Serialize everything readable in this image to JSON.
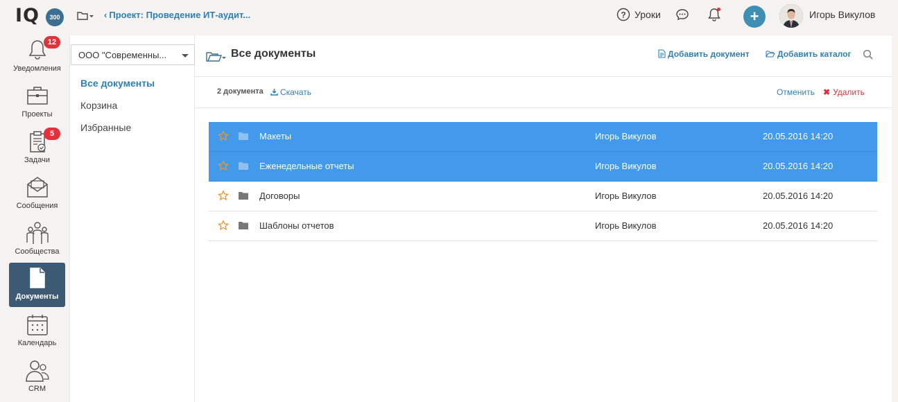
{
  "header": {
    "logo_text": "IQ",
    "logo_badge": "300",
    "breadcrumb": "Проект: Проведение ИТ-аудит...",
    "help_label": "Уроки",
    "user_name": "Игорь Викулов",
    "add_label": "+"
  },
  "nav": {
    "items": [
      {
        "label": "Уведомления",
        "icon": "bell-icon",
        "badge": "12"
      },
      {
        "label": "Проекты",
        "icon": "briefcase-icon"
      },
      {
        "label": "Задачи",
        "icon": "clipboard-icon",
        "badge": "5"
      },
      {
        "label": "Сообщения",
        "icon": "envelope-icon"
      },
      {
        "label": "Сообщества",
        "icon": "people-icon"
      },
      {
        "label": "Документы",
        "icon": "document-icon",
        "active": true
      },
      {
        "label": "Календарь",
        "icon": "calendar-icon"
      },
      {
        "label": "CRM",
        "icon": "crm-icon"
      }
    ]
  },
  "panel": {
    "org_select": "ООО \"Современны...",
    "links": [
      {
        "label": "Все документы",
        "active": true
      },
      {
        "label": "Корзина"
      },
      {
        "label": "Избранные"
      }
    ]
  },
  "main": {
    "title": "Все документы",
    "add_document": "Добавить документ",
    "add_catalog": "Добавить каталог",
    "selection_count": "2 документа",
    "download": "Скачать",
    "cancel": "Отменить",
    "delete": "Удалить",
    "rows": [
      {
        "name": "Макеты",
        "owner": "Игорь Викулов",
        "date": "20.05.2016 14:20",
        "selected": true
      },
      {
        "name": "Еженедельные отчеты",
        "owner": "Игорь Викулов",
        "date": "20.05.2016 14:20",
        "selected": true
      },
      {
        "name": "Договоры",
        "owner": "Игорь Викулов",
        "date": "20.05.2016 14:20",
        "selected": false
      },
      {
        "name": "Шаблоны отчетов",
        "owner": "Игорь Викулов",
        "date": "20.05.2016 14:20",
        "selected": false
      }
    ]
  },
  "colors": {
    "accent": "#2f7fb3",
    "selected_row": "#4399ea",
    "nav_active": "#3d5a74",
    "badge": "#e0323a",
    "delete": "#d9303a",
    "star": "#e8963a"
  }
}
